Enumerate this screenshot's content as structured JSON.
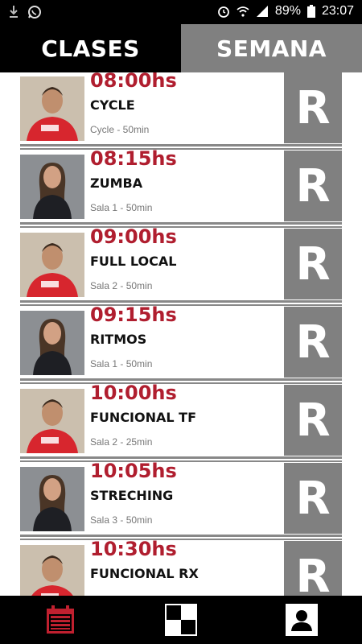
{
  "status": {
    "battery": "89%",
    "time": "23:07"
  },
  "tabs": [
    {
      "label": "CLASES"
    },
    {
      "label": "SEMANA"
    }
  ],
  "classes": [
    {
      "time": "08:00hs",
      "name": "CYCLE",
      "meta": "Cycle - 50min",
      "instructor": "male",
      "reserve": "R"
    },
    {
      "time": "08:15hs",
      "name": "ZUMBA",
      "meta": "Sala 1 - 50min",
      "instructor": "female",
      "reserve": "R"
    },
    {
      "time": "09:00hs",
      "name": "FULL LOCAL",
      "meta": "Sala 2 - 50min",
      "instructor": "male",
      "reserve": "R"
    },
    {
      "time": "09:15hs",
      "name": "RITMOS",
      "meta": "Sala 1 - 50min",
      "instructor": "female",
      "reserve": "R"
    },
    {
      "time": "10:00hs",
      "name": "FUNCIONAL TF",
      "meta": "Sala 2 - 25min",
      "instructor": "male",
      "reserve": "R"
    },
    {
      "time": "10:05hs",
      "name": "STRECHING",
      "meta": "Sala 3 - 50min",
      "instructor": "female",
      "reserve": "R"
    },
    {
      "time": "10:30hs",
      "name": "FUNCIONAL RX",
      "meta": "",
      "instructor": "male",
      "reserve": "R"
    }
  ],
  "colors": {
    "accent": "#b01e2f",
    "gray": "#808080"
  },
  "bottom_nav": [
    {
      "icon": "calendar-icon",
      "active": true
    },
    {
      "icon": "checker-icon",
      "active": false
    },
    {
      "icon": "profile-icon",
      "active": false
    }
  ]
}
